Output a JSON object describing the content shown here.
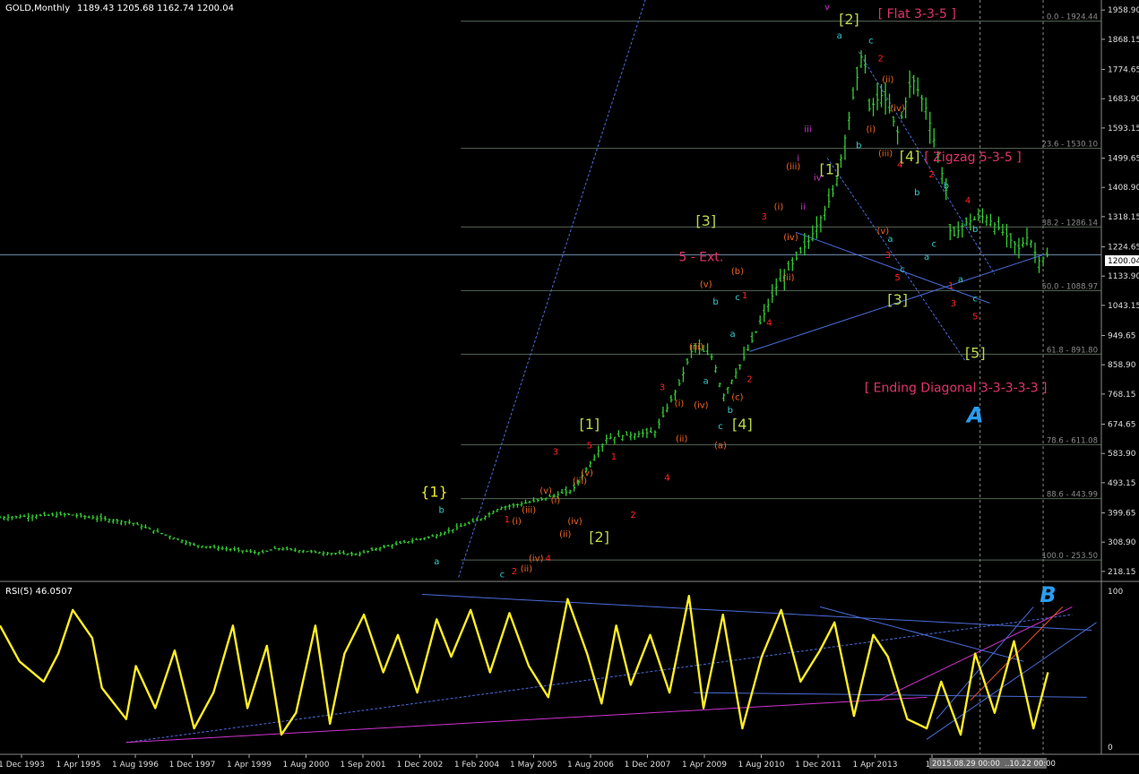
{
  "chart_data": {
    "type": "line",
    "header": {
      "symbol": "GOLD,Monthly",
      "ohlc": "1189.43 1205.68 1162.74 1200.04",
      "last_price": "1200.04"
    },
    "price_axis": {
      "ticks": [
        {
          "label": "1958.90",
          "value": 1958.9
        },
        {
          "label": "1868.15",
          "value": 1868.15
        },
        {
          "label": "1774.65",
          "value": 1774.65
        },
        {
          "label": "1683.90",
          "value": 1683.9
        },
        {
          "label": "1593.15",
          "value": 1593.15
        },
        {
          "label": "1499.65",
          "value": 1499.65
        },
        {
          "label": "1408.90",
          "value": 1408.9
        },
        {
          "label": "1318.15",
          "value": 1318.15
        },
        {
          "label": "1224.65",
          "value": 1224.65
        },
        {
          "label": "1133.90",
          "value": 1133.9
        },
        {
          "label": "1043.15",
          "value": 1043.15
        },
        {
          "label": "949.65",
          "value": 949.65
        },
        {
          "label": "858.90",
          "value": 858.9
        },
        {
          "label": "768.15",
          "value": 768.15
        },
        {
          "label": "674.65",
          "value": 674.65
        },
        {
          "label": "583.90",
          "value": 583.9
        },
        {
          "label": "493.15",
          "value": 493.15
        },
        {
          "label": "399.65",
          "value": 399.65
        },
        {
          "label": "308.90",
          "value": 308.9
        },
        {
          "label": "218.15",
          "value": 218.15
        }
      ]
    },
    "fib_levels": [
      {
        "label": "0.0 - 1924.44",
        "value": 1924.44
      },
      {
        "label": "23.6 - 1530.10",
        "value": 1530.1
      },
      {
        "label": "38.2 - 1286.14",
        "value": 1286.14
      },
      {
        "label": "50.0 - 1088.97",
        "value": 1088.97
      },
      {
        "label": "61.8 - 891.80",
        "value": 891.8
      },
      {
        "label": "78.6 - 611.08",
        "value": 611.08
      },
      {
        "label": "88.6 - 443.99",
        "value": 443.99
      },
      {
        "label": "100.0 - 253.50",
        "value": 253.5
      }
    ],
    "time_axis": {
      "labels": [
        "1 Dec 1993",
        "1 Apr 1995",
        "1 Aug 1996",
        "1 Dec 1997",
        "1 Apr 1999",
        "1 Aug 2000",
        "1 Sep 2001",
        "1 Dec 2002",
        "1 Feb 2004",
        "1 May 2005",
        "1 Aug 2006",
        "1 Dec 2007",
        "1 Apr 2009",
        "1 Aug 2010",
        "1 Dec 2011",
        "1 Apr 2013",
        "1 A"
      ],
      "future_labels": [
        "2015.08.29 00:00",
        "..10.22 00:00"
      ]
    },
    "price_series": {
      "name": "GOLD",
      "x": [
        1993.9,
        1995.3,
        1996.6,
        1997.9,
        1999.3,
        1999.6,
        2000.6,
        2001.3,
        2001.7,
        2002.9,
        2003.8,
        2004.2,
        2004.9,
        2005.7,
        2006.4,
        2006.8,
        2007.4,
        2007.9,
        2008.2,
        2008.6,
        2008.8,
        2009.3,
        2009.9,
        2010.6,
        2011.1,
        2011.7,
        2011.8,
        2012.1,
        2012.4,
        2012.7,
        2013.0,
        2013.4,
        2013.5,
        2013.8,
        2014.2,
        2014.5,
        2014.9,
        2015.1,
        2015.3,
        2015.5
      ],
      "y": [
        385,
        395,
        370,
        300,
        275,
        290,
        275,
        272,
        290,
        330,
        380,
        415,
        435,
        470,
        630,
        640,
        650,
        800,
        920,
        880,
        760,
        900,
        1100,
        1250,
        1400,
        1850,
        1650,
        1700,
        1580,
        1750,
        1650,
        1400,
        1250,
        1300,
        1320,
        1280,
        1220,
        1260,
        1180,
        1200
      ]
    },
    "rsi": {
      "title": "RSI(5) 46.0507",
      "axis_labels": [
        "100",
        "0"
      ],
      "ylim": [
        0,
        100
      ],
      "x": [
        1993.9,
        1994.3,
        1994.8,
        1995.1,
        1995.4,
        1995.8,
        1996.0,
        1996.5,
        1996.7,
        1997.1,
        1997.5,
        1997.9,
        1998.3,
        1998.7,
        1999.0,
        1999.4,
        1999.7,
        2000.0,
        2000.4,
        2000.7,
        2001.0,
        2001.4,
        2001.8,
        2002.1,
        2002.5,
        2002.9,
        2003.2,
        2003.6,
        2004.0,
        2004.4,
        2004.8,
        2005.2,
        2005.6,
        2006.0,
        2006.3,
        2006.6,
        2006.9,
        2007.3,
        2007.7,
        2008.1,
        2008.4,
        2008.8,
        2009.2,
        2009.6,
        2010.0,
        2010.4,
        2010.8,
        2011.1,
        2011.5,
        2011.9,
        2012.2,
        2012.6,
        2013.0,
        2013.3,
        2013.7,
        2014.0,
        2014.4,
        2014.8,
        2015.2,
        2015.5
      ],
      "y": [
        78,
        55,
        42,
        60,
        88,
        70,
        38,
        18,
        52,
        25,
        62,
        12,
        35,
        78,
        25,
        65,
        8,
        22,
        78,
        15,
        60,
        85,
        48,
        72,
        35,
        82,
        58,
        88,
        48,
        86,
        52,
        32,
        95,
        60,
        28,
        78,
        40,
        72,
        35,
        97,
        25,
        85,
        12,
        58,
        88,
        42,
        62,
        80,
        20,
        72,
        58,
        18,
        12,
        42,
        8,
        60,
        22,
        68,
        12,
        48
      ]
    },
    "annotations": {
      "wave_labels": [
        {
          "text": "v",
          "x": 2010.95,
          "y": 1960,
          "color": "#cc33cc"
        },
        {
          "text": "[2]",
          "x": 2011.4,
          "y": 1915,
          "color": "#b8d64a"
        },
        {
          "text": "[ Flat 3-3-5 ]",
          "x": 2012.8,
          "y": 1935,
          "color": "#e0336a"
        },
        {
          "text": "a",
          "x": 2011.2,
          "y": 1870,
          "color": "#33cccc"
        },
        {
          "text": "c",
          "x": 2011.85,
          "y": 1855,
          "color": "#33cccc"
        },
        {
          "text": "2",
          "x": 2012.05,
          "y": 1800,
          "color": "#ff2222"
        },
        {
          "text": "(ii)",
          "x": 2012.2,
          "y": 1735,
          "color": "#ee6622"
        },
        {
          "text": "(iv)",
          "x": 2012.4,
          "y": 1645,
          "color": "#ee6622"
        },
        {
          "text": "(i)",
          "x": 2011.85,
          "y": 1580,
          "color": "#ee6622"
        },
        {
          "text": "b",
          "x": 2011.6,
          "y": 1530,
          "color": "#33cccc"
        },
        {
          "text": "(iii)",
          "x": 2012.15,
          "y": 1505,
          "color": "#ee6622"
        },
        {
          "text": "4",
          "x": 2012.45,
          "y": 1470,
          "color": "#ff2222"
        },
        {
          "text": "[4]",
          "x": 2012.65,
          "y": 1490,
          "color": "#b8d64a"
        },
        {
          "text": "[ Zigzag 5-3-5 ]",
          "x": 2013.95,
          "y": 1490,
          "color": "#e0336a"
        },
        {
          "text": "2",
          "x": 2013.1,
          "y": 1440,
          "color": "#ff2222"
        },
        {
          "text": "b",
          "x": 2013.4,
          "y": 1405,
          "color": "#33cccc"
        },
        {
          "text": "b",
          "x": 2012.8,
          "y": 1385,
          "color": "#33cccc"
        },
        {
          "text": "4",
          "x": 2013.85,
          "y": 1360,
          "color": "#ff2222"
        },
        {
          "text": "iii",
          "x": 2010.55,
          "y": 1580,
          "color": "#cc33cc"
        },
        {
          "text": "[1]",
          "x": 2011.0,
          "y": 1450,
          "color": "#b8d64a"
        },
        {
          "text": "iv",
          "x": 2010.75,
          "y": 1430,
          "color": "#cc33cc"
        },
        {
          "text": "ii",
          "x": 2010.45,
          "y": 1340,
          "color": "#cc33cc"
        },
        {
          "text": "i",
          "x": 2010.35,
          "y": 1490,
          "color": "#cc33cc"
        },
        {
          "text": "(v)",
          "x": 2012.1,
          "y": 1265,
          "color": "#ee6622"
        },
        {
          "text": "a",
          "x": 2012.25,
          "y": 1240,
          "color": "#33cccc"
        },
        {
          "text": "c",
          "x": 2013.15,
          "y": 1225,
          "color": "#33cccc"
        },
        {
          "text": "a",
          "x": 2013.0,
          "y": 1185,
          "color": "#33cccc"
        },
        {
          "text": "b",
          "x": 2014.0,
          "y": 1270,
          "color": "#33cccc"
        },
        {
          "text": "3",
          "x": 2012.2,
          "y": 1190,
          "color": "#ff2222"
        },
        {
          "text": "c",
          "x": 2012.5,
          "y": 1145,
          "color": "#33cccc"
        },
        {
          "text": "5",
          "x": 2012.4,
          "y": 1120,
          "color": "#ff2222"
        },
        {
          "text": "a",
          "x": 2013.7,
          "y": 1115,
          "color": "#33cccc"
        },
        {
          "text": "1",
          "x": 2013.5,
          "y": 1095,
          "color": "#ff2222"
        },
        {
          "text": "[3]",
          "x": 2012.4,
          "y": 1045,
          "color": "#b8d64a"
        },
        {
          "text": "3",
          "x": 2013.55,
          "y": 1040,
          "color": "#ff2222"
        },
        {
          "text": "c",
          "x": 2014.0,
          "y": 1055,
          "color": "#33cccc"
        },
        {
          "text": "5",
          "x": 2014.0,
          "y": 1000,
          "color": "#ff2222"
        },
        {
          "text": "[5]",
          "x": 2014.0,
          "y": 880,
          "color": "#b8d64a"
        },
        {
          "text": "[ Ending Diagonal 3-3-3-3-3 ]",
          "x": 2013.6,
          "y": 775,
          "color": "#e0336a"
        },
        {
          "text": "[3]",
          "x": 2008.45,
          "y": 1290,
          "color": "#b8d64a"
        },
        {
          "text": "3",
          "x": 2009.65,
          "y": 1310,
          "color": "#ff2222"
        },
        {
          "text": "(i)",
          "x": 2009.95,
          "y": 1340,
          "color": "#ee6622"
        },
        {
          "text": "(iii)",
          "x": 2010.25,
          "y": 1465,
          "color": "#ee6622"
        },
        {
          "text": "(iv)",
          "x": 2010.2,
          "y": 1245,
          "color": "#ee6622"
        },
        {
          "text": "(ii)",
          "x": 2010.15,
          "y": 1120,
          "color": "#ee6622"
        },
        {
          "text": "5 - Ext.",
          "x": 2008.35,
          "y": 1180,
          "color": "#e0336a"
        },
        {
          "text": "(b)",
          "x": 2009.1,
          "y": 1140,
          "color": "#ee6622"
        },
        {
          "text": "(v)",
          "x": 2008.45,
          "y": 1100,
          "color": "#ee6622"
        },
        {
          "text": "c",
          "x": 2009.1,
          "y": 1060,
          "color": "#33cccc"
        },
        {
          "text": "1",
          "x": 2009.25,
          "y": 1065,
          "color": "#ff2222"
        },
        {
          "text": "b",
          "x": 2008.65,
          "y": 1045,
          "color": "#33cccc"
        },
        {
          "text": "4",
          "x": 2009.75,
          "y": 980,
          "color": "#ff2222"
        },
        {
          "text": "a",
          "x": 2009.0,
          "y": 945,
          "color": "#33cccc"
        },
        {
          "text": "(iii)",
          "x": 2008.25,
          "y": 905,
          "color": "#ee6622"
        },
        {
          "text": "3",
          "x": 2007.55,
          "y": 780,
          "color": "#ff2222"
        },
        {
          "text": "a",
          "x": 2008.45,
          "y": 800,
          "color": "#33cccc"
        },
        {
          "text": "2",
          "x": 2009.35,
          "y": 805,
          "color": "#ff2222"
        },
        {
          "text": "(c)",
          "x": 2009.1,
          "y": 750,
          "color": "#ee6622"
        },
        {
          "text": "(iv)",
          "x": 2008.35,
          "y": 725,
          "color": "#ee6622"
        },
        {
          "text": "(i)",
          "x": 2007.9,
          "y": 730,
          "color": "#ee6622"
        },
        {
          "text": "b",
          "x": 2008.95,
          "y": 710,
          "color": "#33cccc"
        },
        {
          "text": "(ii)",
          "x": 2007.95,
          "y": 620,
          "color": "#ee6622"
        },
        {
          "text": "c",
          "x": 2008.75,
          "y": 660,
          "color": "#33cccc"
        },
        {
          "text": "[4]",
          "x": 2009.2,
          "y": 660,
          "color": "#b8d64a"
        },
        {
          "text": "(a)",
          "x": 2008.75,
          "y": 600,
          "color": "#ee6622"
        },
        {
          "text": "4",
          "x": 2007.65,
          "y": 500,
          "color": "#ff2222"
        },
        {
          "text": "[1]",
          "x": 2006.05,
          "y": 660,
          "color": "#b8d64a"
        },
        {
          "text": "5",
          "x": 2006.05,
          "y": 600,
          "color": "#ff2222"
        },
        {
          "text": "1",
          "x": 2006.55,
          "y": 565,
          "color": "#ff2222"
        },
        {
          "text": "3",
          "x": 2005.35,
          "y": 580,
          "color": "#ff2222"
        },
        {
          "text": "(v)",
          "x": 2006.0,
          "y": 515,
          "color": "#ee6622"
        },
        {
          "text": "(iii)",
          "x": 2005.85,
          "y": 490,
          "color": "#ee6622"
        },
        {
          "text": "(v)",
          "x": 2005.15,
          "y": 460,
          "color": "#ee6622"
        },
        {
          "text": "(i)",
          "x": 2005.35,
          "y": 430,
          "color": "#ee6622"
        },
        {
          "text": "(iii)",
          "x": 2004.8,
          "y": 400,
          "color": "#ee6622"
        },
        {
          "text": "(iv)",
          "x": 2005.75,
          "y": 365,
          "color": "#ee6622"
        },
        {
          "text": "(ii)",
          "x": 2005.55,
          "y": 325,
          "color": "#ee6622"
        },
        {
          "text": "2",
          "x": 2006.95,
          "y": 385,
          "color": "#ff2222"
        },
        {
          "text": "[2]",
          "x": 2006.25,
          "y": 310,
          "color": "#b8d64a"
        },
        {
          "text": "1",
          "x": 2004.35,
          "y": 370,
          "color": "#ff2222"
        },
        {
          "text": "(i)",
          "x": 2004.55,
          "y": 365,
          "color": "#ee6622"
        },
        {
          "text": "4",
          "x": 2005.2,
          "y": 250,
          "color": "#ff2222"
        },
        {
          "text": "(iv)",
          "x": 2004.95,
          "y": 250,
          "color": "#ee6622"
        },
        {
          "text": "(ii)",
          "x": 2004.75,
          "y": 218,
          "color": "#ee6622"
        },
        {
          "text": "2",
          "x": 2004.5,
          "y": 210,
          "color": "#ff2222"
        },
        {
          "text": "c",
          "x": 2004.25,
          "y": 200,
          "color": "#33cccc"
        },
        {
          "text": "{1}",
          "x": 2002.85,
          "y": 450,
          "color": "#e8e82a"
        },
        {
          "text": "b",
          "x": 2003.0,
          "y": 400,
          "color": "#33cccc"
        },
        {
          "text": "a",
          "x": 2002.9,
          "y": 240,
          "color": "#33cccc"
        }
      ],
      "markers": [
        {
          "text": "A",
          "x": 2014.0,
          "y": 680,
          "panel": "price"
        },
        {
          "text": "B",
          "x": 2015.5,
          "y": 93,
          "panel": "rsi"
        }
      ]
    }
  }
}
